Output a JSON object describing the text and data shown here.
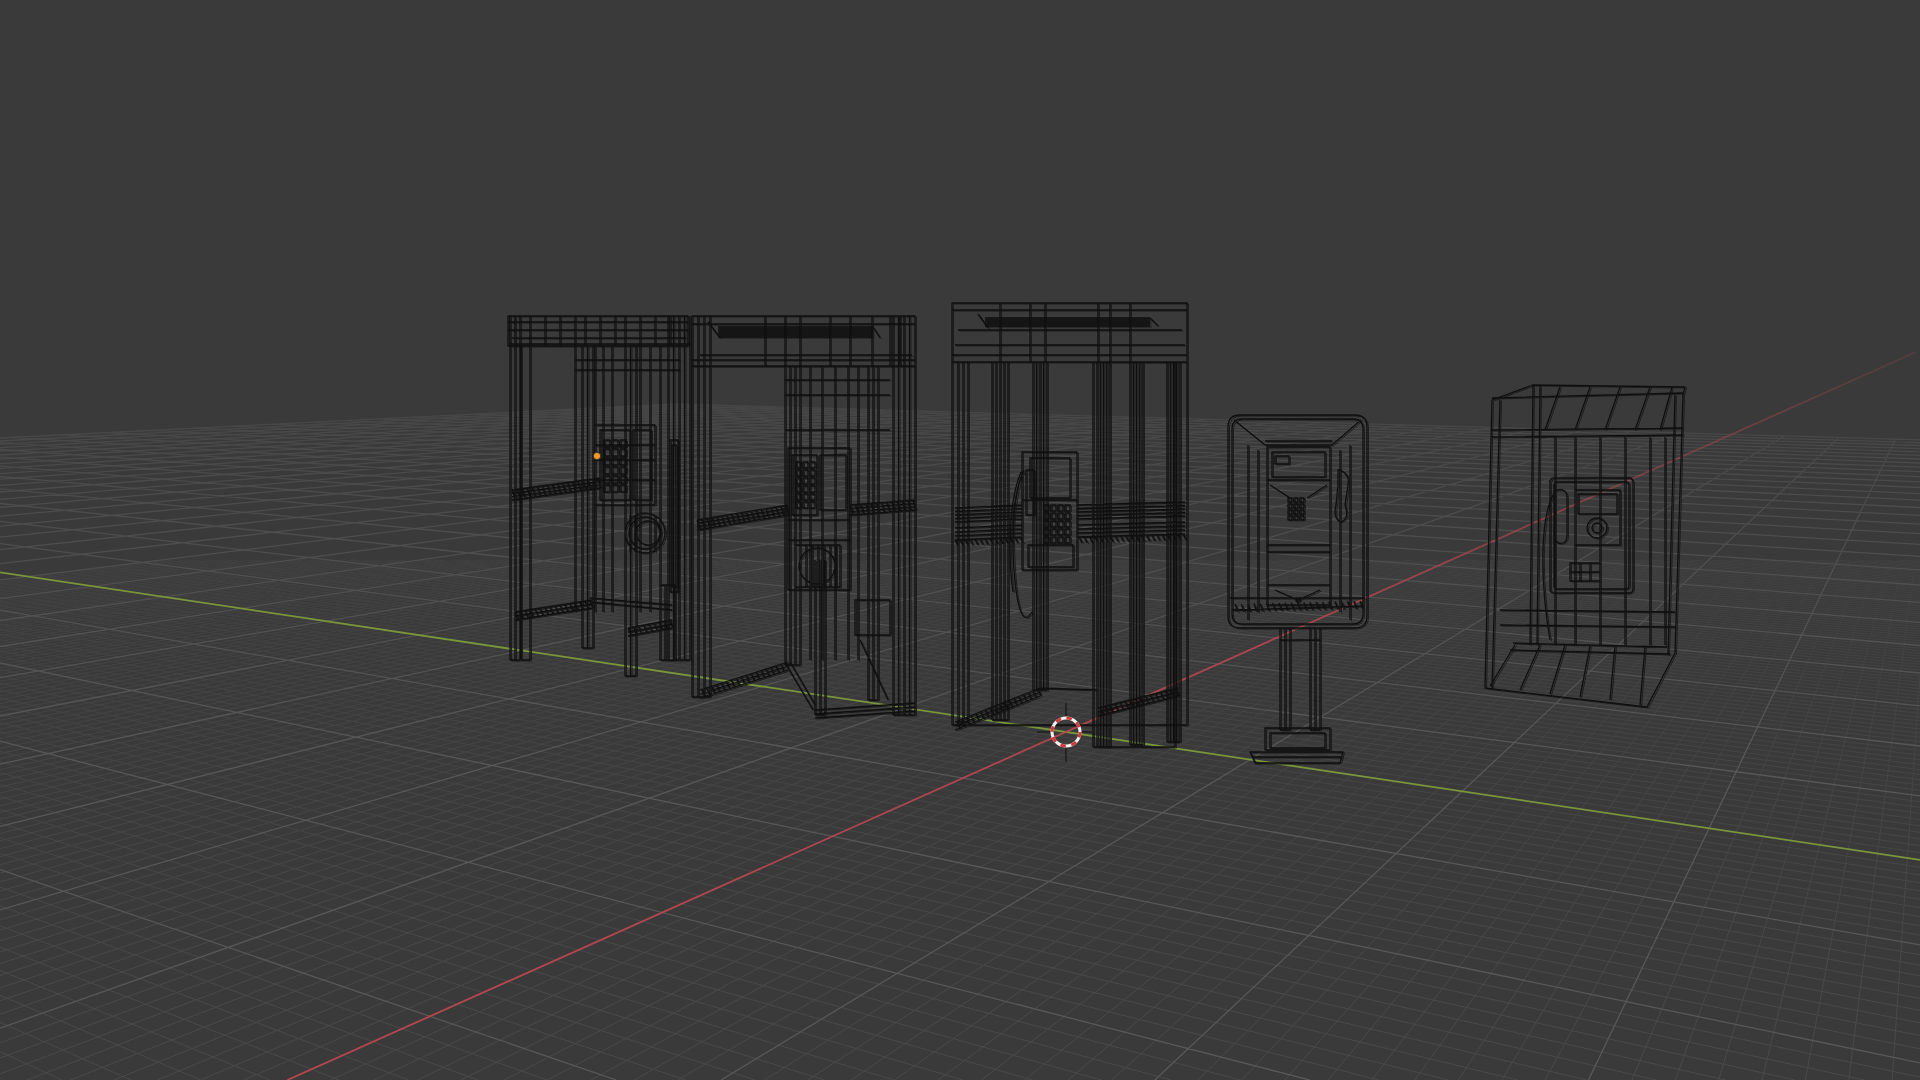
{
  "viewport": {
    "objects": [
      {
        "kind": "open-booth"
      },
      {
        "kind": "side-booth"
      },
      {
        "kind": "glass-booth"
      },
      {
        "kind": "pedestal-payphone"
      },
      {
        "kind": "wall-box"
      }
    ]
  }
}
